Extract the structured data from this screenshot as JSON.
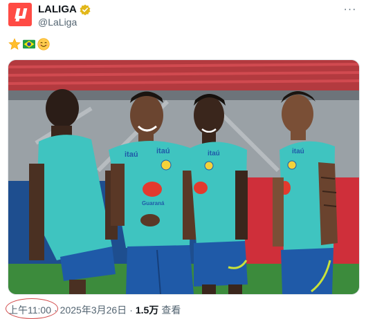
{
  "author": {
    "display_name": "LALIGA",
    "handle": "@LaLiga",
    "avatar_icon": "laliga-logo-icon",
    "brand_color": "#ff4b44",
    "verified_icon": "gold-verified-badge-icon",
    "verified_color": "#e2b719"
  },
  "more_icon": "more-options-icon",
  "more_label": "···",
  "post": {
    "emojis": [
      "star-emoji-icon",
      "brazil-flag-emoji-icon",
      "smiling-face-emoji-icon"
    ]
  },
  "media": {
    "jersey_sponsor": "itaú",
    "chest_logo_text": "Guaraná"
  },
  "meta": {
    "time": "上午11:00",
    "separator": "·",
    "date": "2025年3月26日",
    "views_count": "1.5万",
    "views_label": "查看"
  },
  "colors": {
    "text_primary": "#0f1419",
    "text_secondary": "#536471",
    "annotation_circle": "#d24a4a"
  }
}
